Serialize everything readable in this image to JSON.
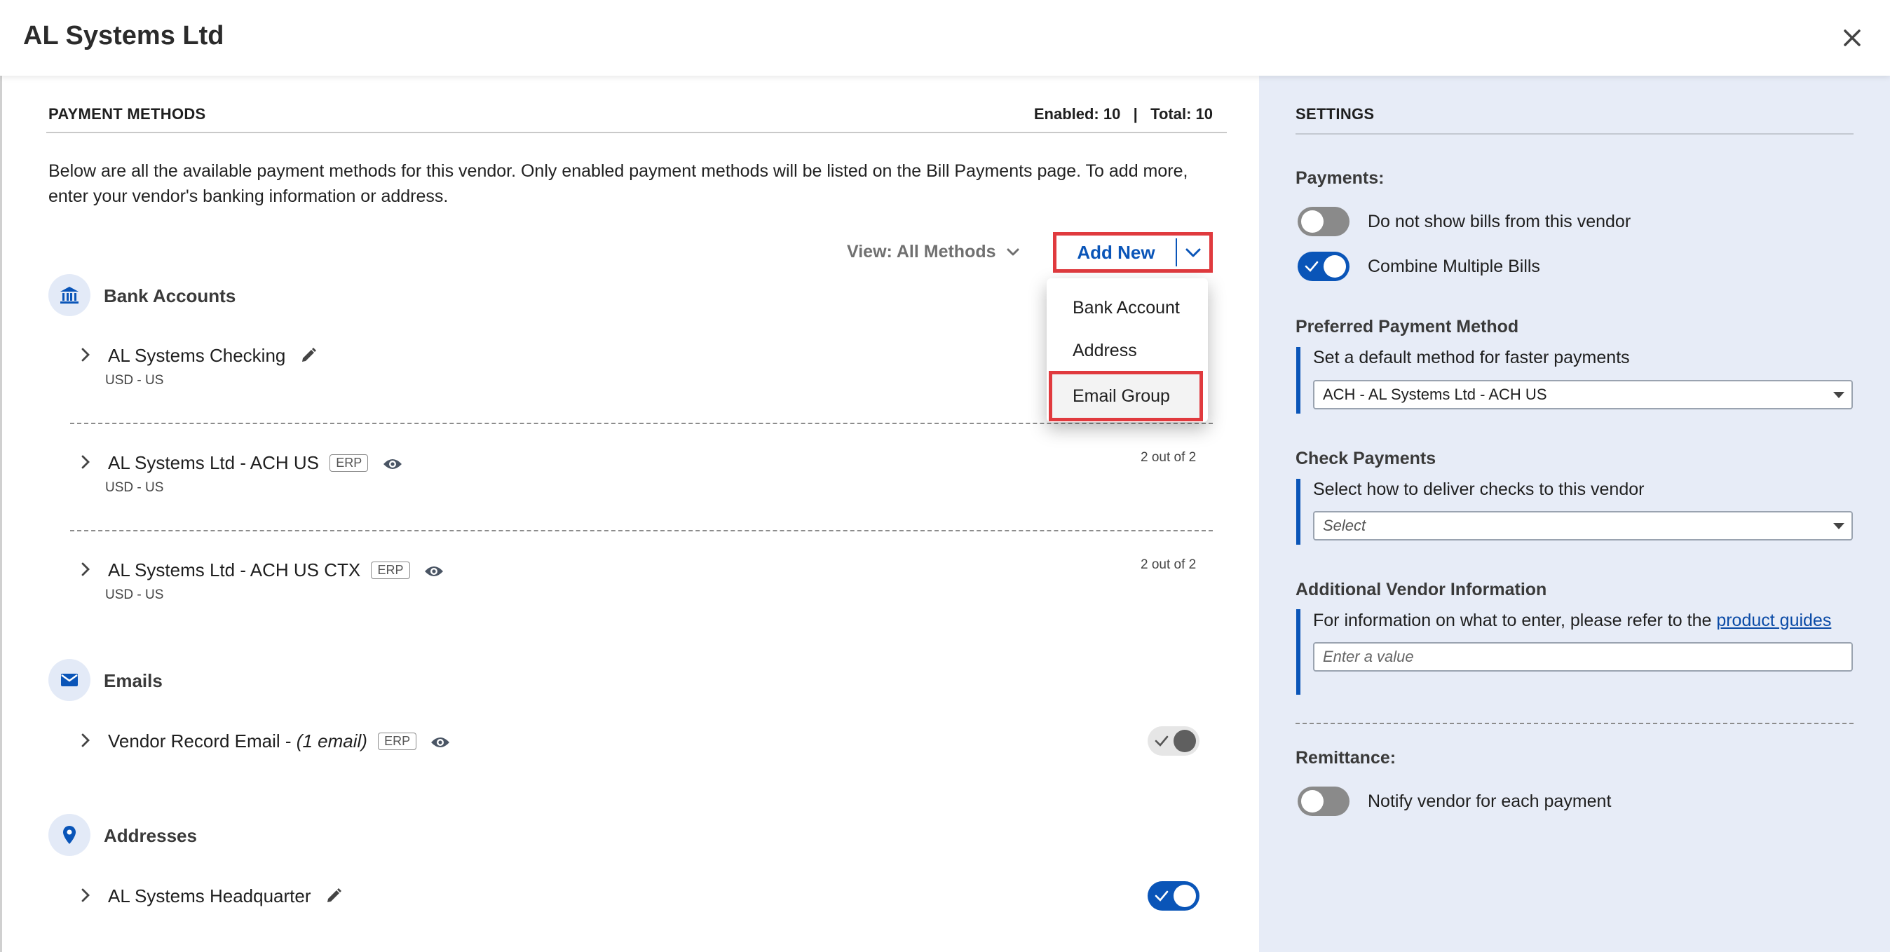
{
  "modal": {
    "title": "AL Systems Ltd",
    "close_icon": "close-icon"
  },
  "payment_methods": {
    "heading": "PAYMENT METHODS",
    "enabled_label": "Enabled: 10",
    "separator": "|",
    "total_label": "Total: 10",
    "description": "Below are all the available payment methods for this vendor. Only enabled payment methods will be listed on the Bill Payments page. To add more, enter your vendor's banking information or address.",
    "view_label": "View: All Methods",
    "add_new_label": "Add New",
    "add_new_menu": [
      "Bank Account",
      "Address",
      "Email Group"
    ],
    "highlight_color": "#e03a3e",
    "accent_color": "#0a55b8"
  },
  "groups": {
    "bank_accounts": {
      "label": "Bank Accounts",
      "icon": "bank-icon",
      "items": [
        {
          "name": "AL Systems Checking",
          "sub": "USD - US"
        },
        {
          "name": "AL Systems Ltd - ACH US",
          "badge": "ERP",
          "sub": "USD - US",
          "count": "2 out of 2"
        },
        {
          "name": "AL Systems Ltd - ACH US CTX",
          "badge": "ERP",
          "sub": "USD - US",
          "count": "2 out of 2"
        }
      ]
    },
    "emails": {
      "label": "Emails",
      "icon": "mail-icon",
      "items": [
        {
          "name": "Vendor Record Email - ",
          "name_italic": "(1 email)",
          "badge": "ERP",
          "enabled": true
        }
      ]
    },
    "addresses": {
      "label": "Addresses",
      "icon": "location-pin-icon",
      "items": [
        {
          "name": "AL Systems Headquarter",
          "enabled": true
        }
      ]
    }
  },
  "settings": {
    "heading": "SETTINGS",
    "payments": {
      "label": "Payments:",
      "toggles": [
        {
          "label": "Do not show bills from this vendor",
          "on": false
        },
        {
          "label": "Combine Multiple Bills",
          "on": true
        }
      ]
    },
    "preferred": {
      "label": "Preferred Payment Method",
      "help": "Set a default method for faster payments",
      "value": "ACH - AL Systems Ltd - ACH US"
    },
    "check_payments": {
      "label": "Check Payments",
      "help": "Select how to deliver checks to this vendor",
      "value": "Select"
    },
    "additional": {
      "label": "Additional Vendor Information",
      "help_prefix": "For information on what to enter, please refer to the ",
      "help_link": "product guides",
      "placeholder": "Enter a value"
    },
    "remittance": {
      "label": "Remittance:",
      "toggle_label": "Notify vendor for each payment",
      "on": false
    }
  }
}
